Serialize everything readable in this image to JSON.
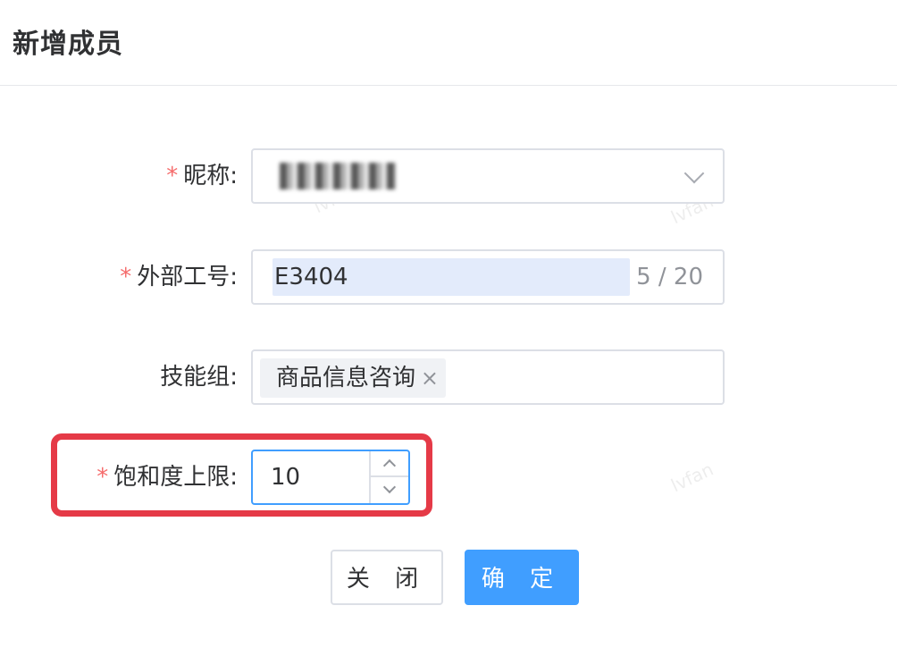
{
  "dialog": {
    "title": "新增成员"
  },
  "form": {
    "nickname": {
      "label": "昵称:",
      "required": "*"
    },
    "external_id": {
      "label": "外部工号:",
      "required": "*",
      "value": "E3404",
      "counter": "5 / 20"
    },
    "skill_group": {
      "label": "技能组:",
      "tags": [
        "商品信息咨询"
      ],
      "tag_close": "×"
    },
    "saturation": {
      "label": "饱和度上限:",
      "required": "*",
      "value": "10"
    }
  },
  "footer": {
    "close_label": "关 闭",
    "confirm_label": "确 定"
  },
  "watermark": "lvfan",
  "colors": {
    "primary": "#409eff",
    "danger": "#f56c6c",
    "highlight": "#e53a47"
  }
}
